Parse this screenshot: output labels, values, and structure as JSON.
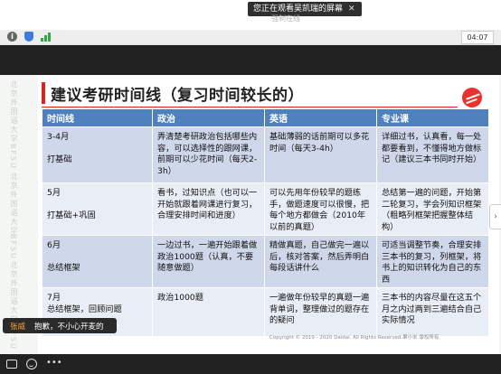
{
  "share_banner": {
    "text": "您正在观看吴凯瑞的屏幕",
    "close": "✕"
  },
  "faint_title": "强制在线",
  "toolbar": {
    "time": "04:07"
  },
  "slide": {
    "title": "建议考研时间线（复习时间较长的）",
    "watermark": [
      "北京外国语大学",
      "BFSU",
      "北京外国语大学",
      "BFSU",
      "北京外国语大学",
      "BFSU"
    ],
    "table": {
      "headers": [
        "时间线",
        "政治",
        "英语",
        "专业课"
      ],
      "rows": [
        {
          "timeline": [
            "3-4月",
            "",
            "打基础"
          ],
          "politics": "弄清楚考研政治包括哪些内容，可以选择性的跟网课，前期可以少花时间（每天2-3h）",
          "english": "基础薄弱的话前期可以多花时间（每天3-4h）",
          "major": "详细过书，认真看，每一处都要看到，不懂得地方做标记（建议三本书同时开始）"
        },
        {
          "timeline": [
            "5月",
            "",
            "打基础+巩固"
          ],
          "politics": "看书，过知识点（也可以一开始就跟着网课进行复习，合理安排时间和进度）",
          "english": "可以先用年份较早的题练手，做题速度可以很慢，把每个地方都做会（2010年以前的真题）",
          "major": "总结第一遍的问题，开始第二轮复习，学会列知识框架（粗略列框架把握整体结构）"
        },
        {
          "timeline": [
            "6月",
            "",
            "总结框架"
          ],
          "politics": "一边过书，一遍开始跟着做政治1000题（认真，不要随意做题）",
          "english": "精做真题，自己做完一遍以后，核对答案，然后弄明白每段话讲什么",
          "major": "可适当调整节奏，合理安排三本书的复习，列框架，将书上的知识转化为自己的东西"
        },
        {
          "timeline": [
            "7月",
            "总结框架，回顾问题"
          ],
          "politics": "政治1000题",
          "english": "一遍做年份较早的真题一遍背单词，整理做过的题存在的疑问",
          "major": "三本书的内容尽量在这五个月之内过两到三遍结合自己实际情况"
        }
      ]
    },
    "copyright": "Copyright © 2019 - 2020 Daidai. All Rights Reserved.果小米 版权所有"
  },
  "chat": {
    "name": "张威",
    "message": "抱歉，不小心开麦的"
  },
  "icons": [
    "info-icon",
    "shield-icon",
    "signal-icon",
    "keyboard-icon",
    "emoji-icon",
    "more-icon",
    "slide-handle-icon"
  ]
}
